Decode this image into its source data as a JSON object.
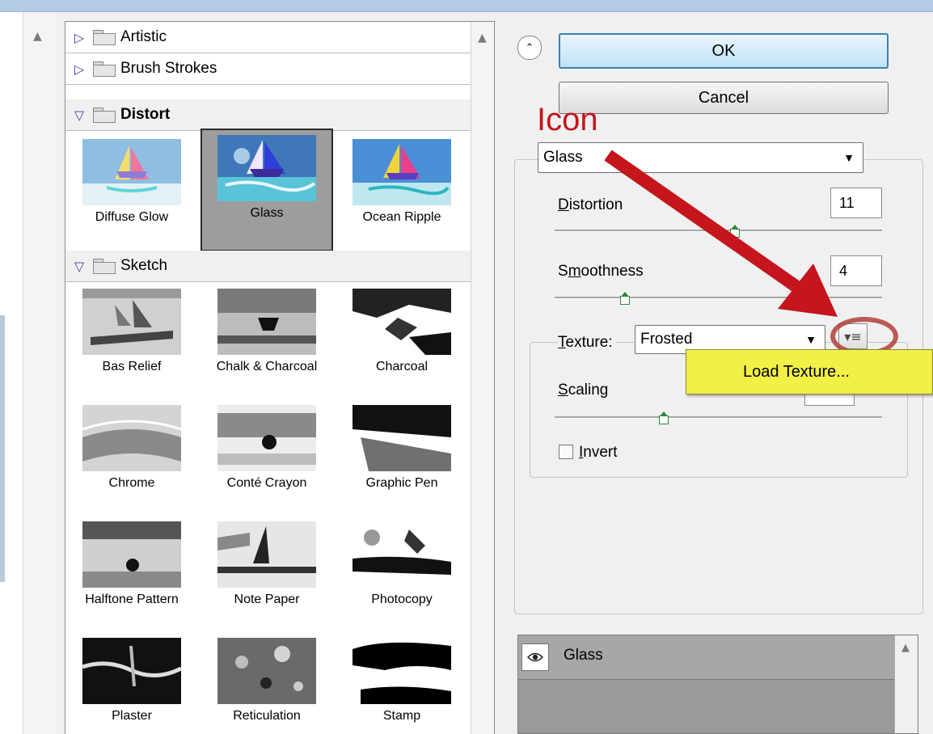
{
  "gallery": {
    "categories": [
      {
        "label": "Artistic",
        "expanded": false
      },
      {
        "label": "Brush Strokes",
        "expanded": false
      },
      {
        "label": "Distort",
        "expanded": true,
        "bold": true
      },
      {
        "label": "Sketch",
        "expanded": true
      }
    ],
    "distort_items": [
      "Diffuse Glow",
      "Glass",
      "Ocean Ripple"
    ],
    "selected_filter": "Glass",
    "sketch_items": [
      "Bas Relief",
      "Chalk & Charcoal",
      "Charcoal",
      "Chrome",
      "Conté Crayon",
      "Graphic Pen",
      "Halftone Pattern",
      "Note Paper",
      "Photocopy",
      "Plaster",
      "Reticulation",
      "Stamp"
    ]
  },
  "buttons": {
    "ok": "OK",
    "cancel": "Cancel"
  },
  "annotation": {
    "text": "Icon",
    "color": "#c4161c"
  },
  "settings": {
    "filter_select": "Glass",
    "distortion": {
      "label_prefix": "D",
      "label_rest": "istortion",
      "value": "11",
      "level": 11,
      "max": 20
    },
    "smoothness": {
      "label_pre": "S",
      "label_acc": "m",
      "label_rest": "oothness",
      "value": "4",
      "level": 4,
      "min": 1,
      "max": 15
    },
    "texture": {
      "label_pre": "",
      "label_acc": "T",
      "label_rest": "exture:",
      "value": "Frosted"
    },
    "scaling": {
      "label_acc": "S",
      "label_rest": "caling",
      "level": 100,
      "min": 50,
      "max": 200
    },
    "invert": {
      "label_acc": "I",
      "label_rest": "nvert",
      "checked": false
    }
  },
  "popup": {
    "item": "Load Texture..."
  },
  "layers": {
    "items": [
      {
        "name": "Glass",
        "visible": true
      }
    ]
  },
  "colors": {
    "accent_blue": "#3c7fb1",
    "popup_yellow": "#f2ef47",
    "arrow_red": "#c4161c"
  },
  "icons": {
    "eye": "eye-icon",
    "collapse": "double-chevron-up-icon",
    "menu": "panel-menu-icon",
    "dropdown": "dropdown-arrow-icon"
  }
}
